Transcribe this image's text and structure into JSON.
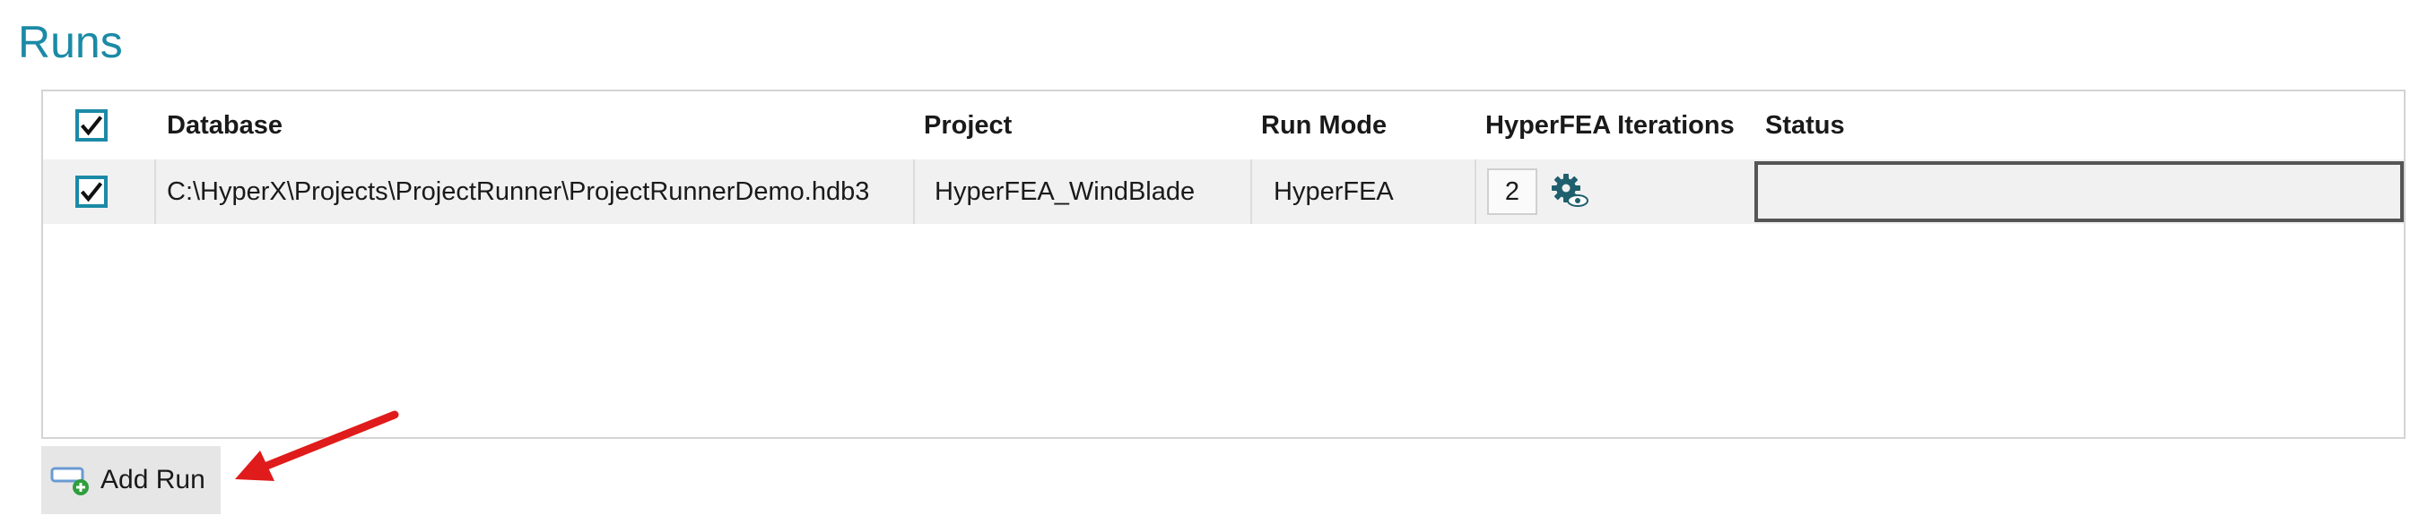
{
  "section": {
    "title": "Runs"
  },
  "table": {
    "headers": {
      "database": "Database",
      "project": "Project",
      "run_mode": "Run Mode",
      "iterations": "HyperFEA Iterations",
      "status": "Status"
    },
    "select_all_checked": true,
    "rows": [
      {
        "checked": true,
        "database": "C:\\HyperX\\Projects\\ProjectRunner\\ProjectRunnerDemo.hdb3",
        "project": "HyperFEA_WindBlade",
        "run_mode": "HyperFEA",
        "iterations": "2",
        "status": ""
      }
    ]
  },
  "actions": {
    "add_run_label": "Add Run"
  },
  "colors": {
    "accent": "#1b8aa6",
    "arrow": "#e01b1b"
  },
  "icons": {
    "settings": "gear-eye-icon",
    "add_run": "add-row-icon"
  }
}
